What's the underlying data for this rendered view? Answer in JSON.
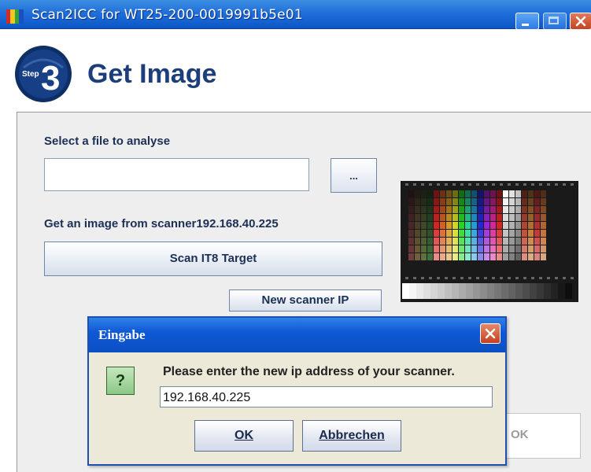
{
  "window": {
    "title": "Scan2ICC for WT25-200-0019991b5e01",
    "step_badge_small": "Step",
    "step_number": "3",
    "page_title": "Get Image"
  },
  "main": {
    "select_file_label": "Select a file to analyse",
    "file_path_value": "",
    "browse_button_label": "...",
    "scanner_label": "Get an image from scanner192.168.40.225",
    "scan_button_label": "Scan IT8 Target",
    "new_ip_button_label": "New scanner IP",
    "ok_button_label": "OK"
  },
  "dialog": {
    "title": "Eingabe",
    "question_icon": "?",
    "prompt": "Please enter the new ip address of your scanner.",
    "ip_value": "192.168.40.225",
    "ok_label": "OK",
    "cancel_label": "Abbrechen"
  },
  "colors": {
    "titlebar": "#1f6fd9",
    "title_text": "#1c3f7c",
    "panel": "#eeeeee",
    "dialog_bg": "#ece9d8",
    "close_button": "#c6401c"
  }
}
